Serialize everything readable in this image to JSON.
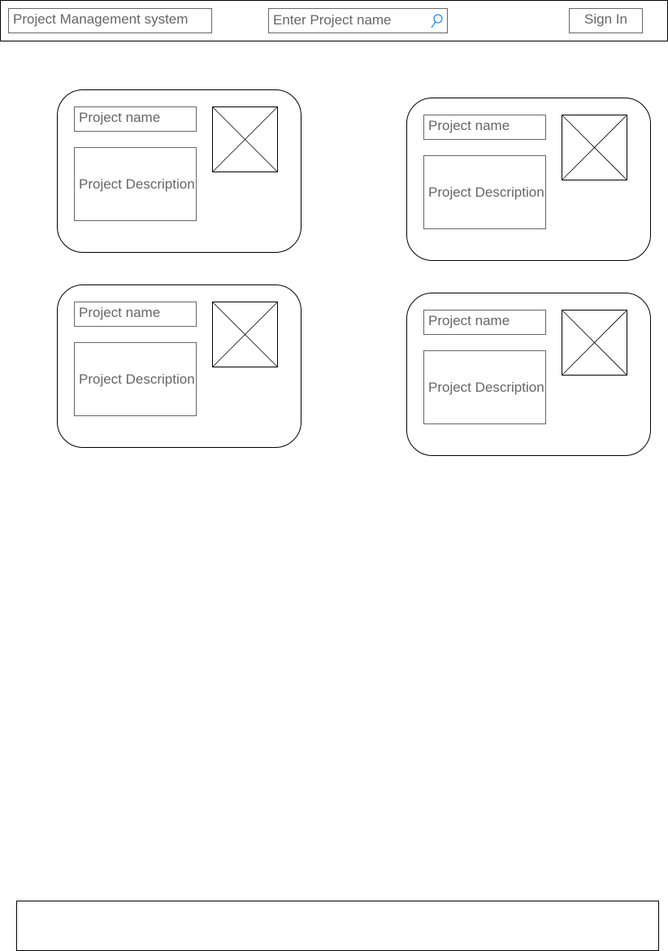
{
  "header": {
    "title": "Project Management system",
    "search_placeholder": "Enter Project name",
    "search_icon": "magnifier-icon",
    "sign_in_label": "Sign In"
  },
  "cards": [
    {
      "name": "Project name",
      "description": "Project Description",
      "image": "image-placeholder"
    },
    {
      "name": "Project name",
      "description": "Project Description",
      "image": "image-placeholder"
    },
    {
      "name": "Project name",
      "description": "Project Description",
      "image": "image-placeholder"
    },
    {
      "name": "Project name",
      "description": "Project Description",
      "image": "image-placeholder"
    }
  ],
  "colors": {
    "search_icon": "#1e88e5",
    "text": "#666666",
    "border": "#000000"
  }
}
